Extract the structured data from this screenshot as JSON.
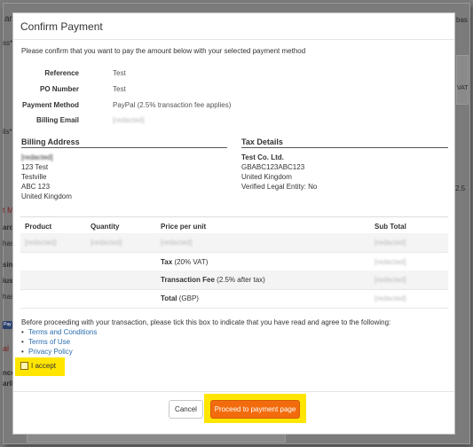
{
  "modal": {
    "title": "Confirm Payment",
    "intro": "Please confirm that you want to pay the amount below with your selected payment method"
  },
  "details": [
    {
      "label": "Reference",
      "value": "Test"
    },
    {
      "label": "PO Number",
      "value": "Test"
    },
    {
      "label": "Payment Method",
      "value": "PayPal (2.5% transaction fee applies)"
    },
    {
      "label": "Billing Email",
      "value": "[redacted]"
    }
  ],
  "billing_address": {
    "title": "Billing Address",
    "lines": [
      "[redacted]",
      "123 Test",
      "Testville",
      "ABC 123",
      "United Kingdom"
    ]
  },
  "tax_details": {
    "title": "Tax Details",
    "company": "Test Co. Ltd.",
    "lines": [
      "GBABC123ABC123",
      "United Kingdom",
      "Verified Legal Entity: No"
    ]
  },
  "table": {
    "headers": {
      "product": "Product",
      "quantity": "Quantity",
      "price": "Price per unit",
      "subtotal": "Sub Total"
    },
    "item": {
      "product": "[redacted]",
      "quantity": "[redacted]",
      "price": "[redacted]",
      "subtotal": "[redacted]"
    },
    "tax": {
      "label": "Tax",
      "note": "(20% VAT)",
      "value": "[redacted]"
    },
    "fee": {
      "label": "Transaction Fee",
      "note": "(2.5% after tax)",
      "value": "[redacted]"
    },
    "total": {
      "label": "Total",
      "note": "(GBP)",
      "value": "[redacted]"
    }
  },
  "terms": {
    "text": "Before proceeding with your transaction, please tick this box to indicate that you have read and agree to the following:",
    "links": [
      "Terms and Conditions",
      "Terms of Use",
      "Privacy Policy"
    ],
    "accept_label": "I accept"
  },
  "buttons": {
    "cancel": "Cancel",
    "proceed": "Proceed to payment page"
  },
  "background": {
    "fragments": [
      "ar",
      "ss*",
      "ils*",
      "t M",
      "ard",
      "has",
      "sin",
      "ius",
      "has",
      "al",
      "nce",
      "arli",
      "bas",
      "VAT",
      "2.5",
      "Pay"
    ]
  },
  "colors": {
    "accent": "#f26c0d",
    "highlight": "#ffe500",
    "link": "#2a6db0"
  }
}
